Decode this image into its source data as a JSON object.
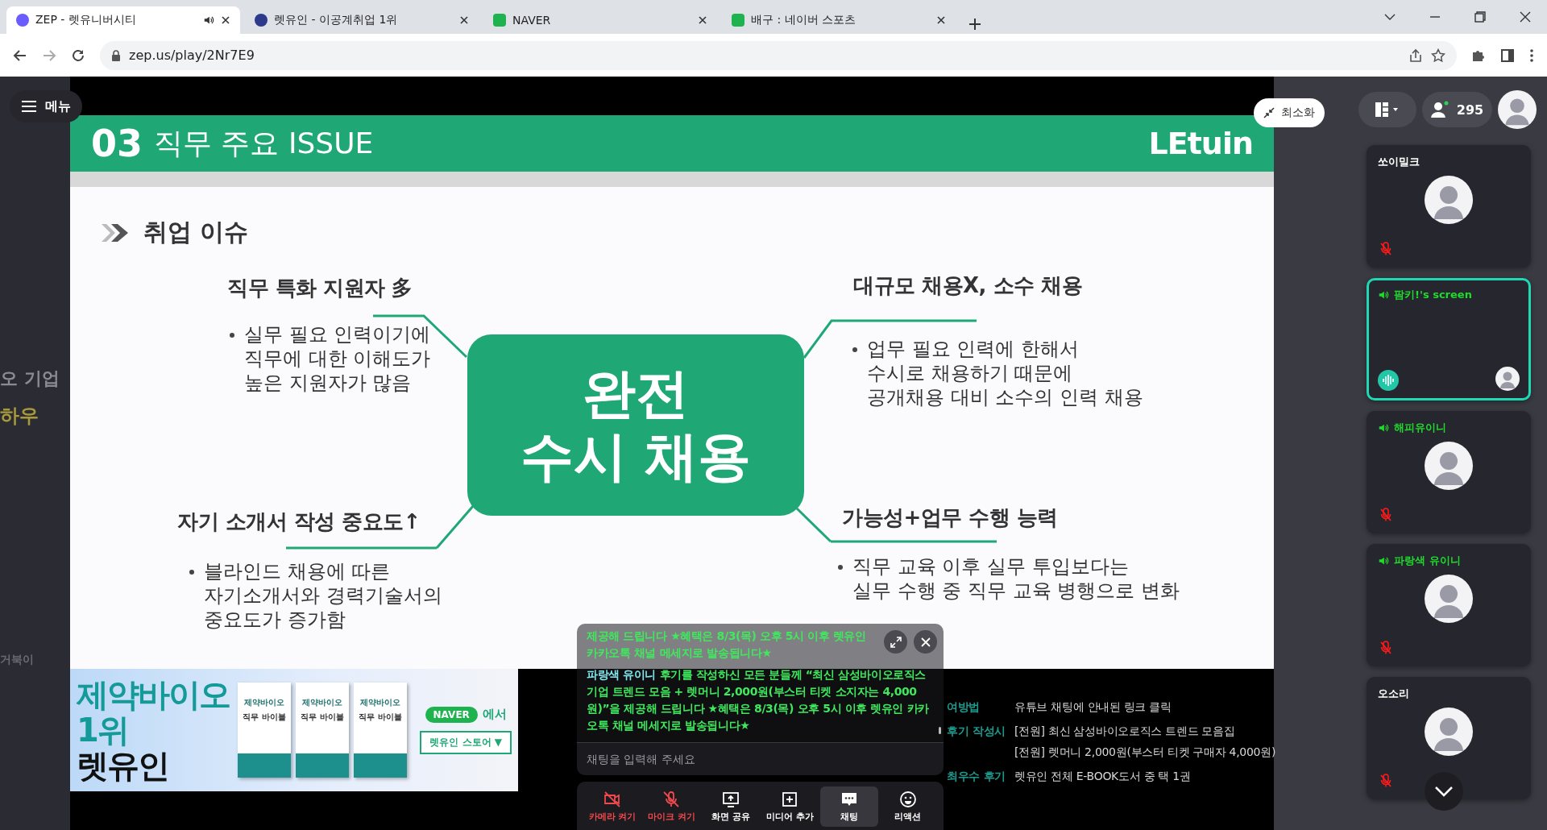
{
  "browser": {
    "tabs": [
      {
        "title": "ZEP - 렛유니버시티",
        "selected": true,
        "audio": true
      },
      {
        "title": "렛유인 - 이공계취업 1위",
        "selected": false,
        "audio": false
      },
      {
        "title": "NAVER",
        "selected": false,
        "audio": false
      },
      {
        "title": "배구 : 네이버 스포츠",
        "selected": false,
        "audio": false
      }
    ],
    "address": "zep.us/play/2Nr7E9"
  },
  "menu_button": {
    "label": "메뉴"
  },
  "minimize_button": {
    "label": "최소화"
  },
  "game_map": {
    "labels": [
      "오 기업",
      "하우",
      "거북이"
    ]
  },
  "slide": {
    "number": "03",
    "title": "직무 주요 ISSUE",
    "logo": "LEtuin",
    "section": "취업 이슈",
    "center": [
      "완전",
      "수시 채용"
    ],
    "quadrants": [
      {
        "heading": "직무 특화 지원자 多",
        "lines": [
          "실무 필요 인력이기에",
          "직무에 대한 이해도가",
          "높은 지원자가 많음"
        ]
      },
      {
        "heading": "대규모 채용X, 소수 채용",
        "lines": [
          "업무 필요 인력에 한해서",
          "수시로 채용하기 때문에",
          "공개채용 대비 소수의 인력 채용"
        ]
      },
      {
        "heading": "자기 소개서 작성 중요도↑",
        "lines": [
          "블라인드 채용에 따른",
          "자기소개서와 경력기술서의",
          "중요도가 증가함"
        ]
      },
      {
        "heading": "가능성+업무 수행 능력",
        "lines": [
          "직무 교육 이후 실무 투입보다는",
          "실무 수행 중 직무 교육 병행으로 변화"
        ]
      }
    ]
  },
  "banner": {
    "headline": [
      "제약바이오",
      "1위",
      "렛유인"
    ],
    "books": [
      {
        "series": "제약바이오",
        "title": "직무 바이블"
      },
      {
        "series": "제약바이오",
        "title": "직무 바이블"
      },
      {
        "series": "제약바이오",
        "title": "직무 바이블"
      }
    ],
    "naver": "NAVER",
    "naver_suffix": "에서",
    "store_button": "렛유인 스토어 ▼"
  },
  "notes": [
    {
      "label": "여방법",
      "values": [
        "유튜브 채팅에 안내된 링크 클릭"
      ]
    },
    {
      "label": "후기 작성시",
      "values": [
        "[전원] 최신 삼성바이오로직스 트렌드 모음집",
        "[전원] 렛머니 2,000원(부스터 티켓 구매자 4,000원)"
      ]
    },
    {
      "label": "최우수 후기",
      "values": [
        "렛유인 전체 E-BOOK도서 중 택 1권"
      ]
    }
  ],
  "chat": {
    "messages": [
      {
        "text": "제공해 드립니다 ★혜택은 8/3(목) 오후 5시 이후 렛유인 카카오톡 채널 메세지로 발송됩니다★"
      },
      {
        "sender": "파랑색 유이니",
        "text": "후기를 작성하신 모든 분들께 “최신 삼성바이오로직스 기업 트렌드 모음 + 렛머니 2,000원(부스터 티켓 소지자는 4,000원)”을 제공해 드립니다 ★혜택은 8/3(목) 오후 5시 이후 렛유인 카카오톡 채널 메세지로 발송됩니다★"
      }
    ],
    "placeholder": "채팅을 입력해 주세요"
  },
  "toolbar": [
    {
      "kind": "camera",
      "label": "카메라 켜기",
      "off": true,
      "selected": false
    },
    {
      "kind": "mic",
      "label": "마이크 켜기",
      "off": true,
      "selected": false
    },
    {
      "kind": "screen",
      "label": "화면 공유",
      "off": false,
      "selected": false
    },
    {
      "kind": "media",
      "label": "미디어 추가",
      "off": false,
      "selected": false
    },
    {
      "kind": "chat",
      "label": "채팅",
      "off": false,
      "selected": true
    },
    {
      "kind": "reaction",
      "label": "리액션",
      "off": false,
      "selected": false
    }
  ],
  "people": {
    "count": "295"
  },
  "cards": [
    {
      "kind": "avatar",
      "name": "쏘이밀크",
      "speaking": false,
      "muted": true,
      "highlighted": false
    },
    {
      "kind": "screen",
      "name": "팜키!'s screen",
      "speaking": true,
      "muted": false,
      "highlighted": true
    },
    {
      "kind": "avatar",
      "name": "해피유이니",
      "speaking": true,
      "muted": true,
      "highlighted": false
    },
    {
      "kind": "avatar",
      "name": "파랑색 유이니",
      "speaking": true,
      "muted": true,
      "highlighted": false
    },
    {
      "kind": "avatar",
      "name": "오소리",
      "speaking": false,
      "muted": true,
      "highlighted": false
    }
  ]
}
